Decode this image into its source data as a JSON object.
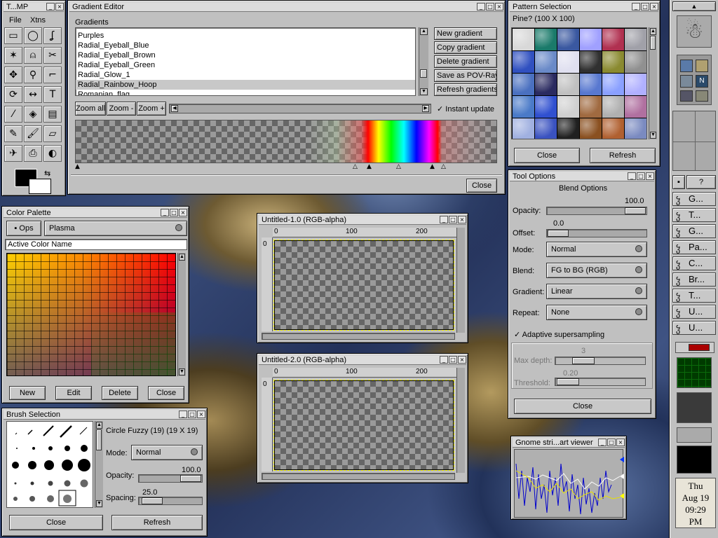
{
  "toolbox": {
    "title": "T...MP",
    "menu": [
      "File",
      "Xtns"
    ],
    "tools": [
      "rect-select-icon",
      "ellipse-select-icon",
      "lasso-icon",
      "magic-wand-icon",
      "bezier-select-icon",
      "scissors-icon",
      "move-icon",
      "magnify-icon",
      "crop-icon",
      "transform-icon",
      "flip-icon",
      "text-icon",
      "color-picker-icon",
      "bucket-fill-icon",
      "blend-icon",
      "pencil-icon",
      "paintbrush-icon",
      "eraser-icon",
      "airbrush-icon",
      "clone-icon",
      "convolve-icon"
    ]
  },
  "gradient_editor": {
    "title": "Gradient Editor",
    "list_label": "Gradients",
    "items": [
      "Purples",
      "Radial_Eyeball_Blue",
      "Radial_Eyeball_Brown",
      "Radial_Eyeball_Green",
      "Radial_Glow_1",
      "Radial_Rainbow_Hoop",
      "Romanian_flag"
    ],
    "selected_index": 5,
    "buttons": [
      "New gradient",
      "Copy gradient",
      "Delete gradient",
      "Save as POV-Ray",
      "Refresh gradients"
    ],
    "zoom": [
      "Zoom all",
      "Zoom -",
      "Zoom +"
    ],
    "instant_update": "Instant update",
    "close": "Close"
  },
  "pattern": {
    "title": "Pattern Selection",
    "name": "Pine?",
    "size": "(100 X 100)",
    "close": "Close",
    "refresh": "Refresh"
  },
  "tool_options": {
    "title": "Tool Options",
    "heading": "Blend Options",
    "opacity_label": "Opacity:",
    "opacity_value": "100.0",
    "offset_label": "Offset:",
    "offset_value": "0.0",
    "mode_label": "Mode:",
    "mode": "Normal",
    "blend_label": "Blend:",
    "blend": "FG to BG (RGB)",
    "gradient_label": "Gradient:",
    "gradient": "Linear",
    "repeat_label": "Repeat:",
    "repeat": "None",
    "adaptive": "Adaptive supersampling",
    "max_depth_label": "Max depth:",
    "max_depth": "3",
    "threshold_label": "Threshold:",
    "threshold": "0.20",
    "close": "Close"
  },
  "palette": {
    "title": "Color Palette",
    "ops": "Ops",
    "palette_name": "Plasma",
    "color_name": "Active Color Name",
    "buttons": [
      "New",
      "Edit",
      "Delete",
      "Close"
    ]
  },
  "brush": {
    "title": "Brush Selection",
    "name": "Circle Fuzzy (19)",
    "size": "(19 X 19)",
    "mode_label": "Mode:",
    "mode": "Normal",
    "opacity_label": "Opacity:",
    "opacity_value": "100.0",
    "spacing_label": "Spacing:",
    "spacing_value": "25.0",
    "close": "Close",
    "refresh": "Refresh"
  },
  "image1": {
    "title": "Untitled-1.0 (RGB-alpha)",
    "ticks": [
      "0",
      "100",
      "200"
    ]
  },
  "image2": {
    "title": "Untitled-2.0 (RGB-alpha)",
    "ticks": [
      "0",
      "100",
      "200"
    ]
  },
  "chart": {
    "title": "Gnome stri...art viewer"
  },
  "clock": {
    "day": "Thu",
    "date": "Aug 19",
    "time": "09:29",
    "ampm": "PM"
  },
  "dock": {
    "tasks": [
      "G...",
      "T...",
      "G...",
      "Pa...",
      "C...",
      "Br...",
      "T...",
      "U...",
      "U..."
    ],
    "help": "?"
  }
}
